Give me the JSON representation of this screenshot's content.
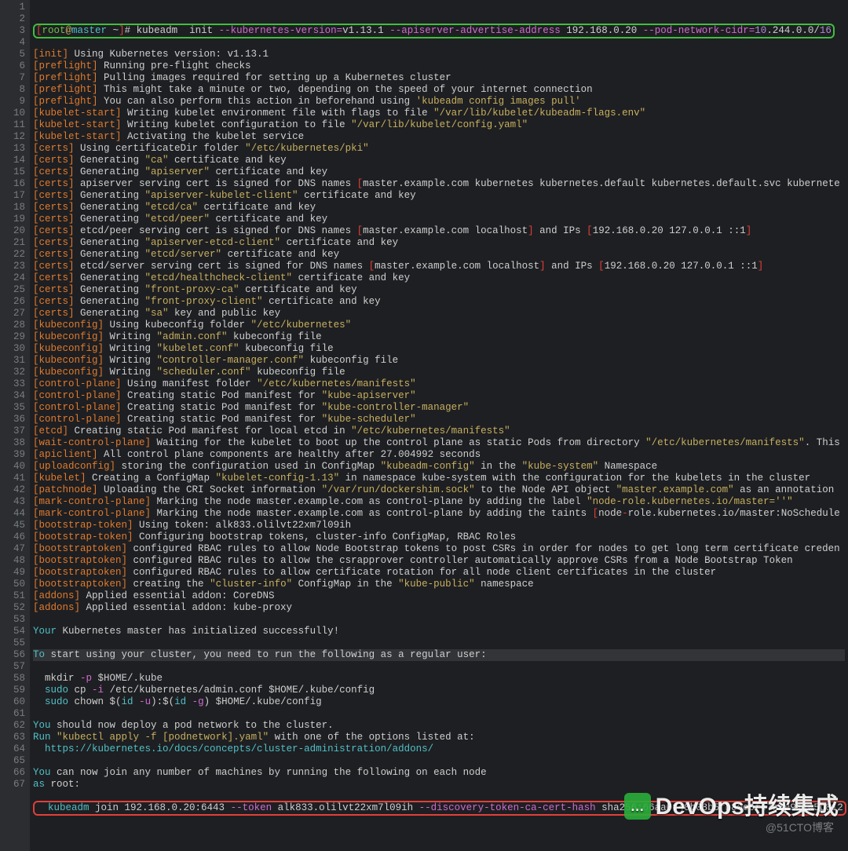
{
  "total_lines": 67,
  "highlight_line": 54,
  "box_green_line": 1,
  "box_red_line": 67,
  "watermark": {
    "text": "DevOps持续集成",
    "sub": "@51CTO博客"
  },
  "prompt": {
    "lb": "[",
    "user": "root",
    "at": "@",
    "host": "master",
    "path": " ~",
    "rb": "]",
    "hash": "# "
  },
  "cmd": {
    "bin": "kubeadm",
    "sub": "  init ",
    "f1": "--kubernetes-version=",
    "v1": "v1.13.1 ",
    "f2": "--apiserver-advertise-address ",
    "v2": "192.168.0.20 ",
    "f3": "--pod-network-cidr=",
    "v3a": "10",
    "v3b": ".244.0.0/",
    "v3c": "16"
  },
  "lines": {
    "3": [
      [
        "br",
        "[init]"
      ],
      [
        "w",
        " Using Kubernetes version: v1.13.1"
      ]
    ],
    "4": [
      [
        "br",
        "[preflight]"
      ],
      [
        "w",
        " Running pre-flight checks"
      ]
    ],
    "5": [
      [
        "br",
        "[preflight]"
      ],
      [
        "w",
        " Pulling images required for setting up a Kubernetes cluster"
      ]
    ],
    "6": [
      [
        "br",
        "[preflight]"
      ],
      [
        "w",
        " This might take a minute or two, depending on the speed of your internet connection"
      ]
    ],
    "7": [
      [
        "br",
        "[preflight]"
      ],
      [
        "w",
        " You can also perform this action in beforehand using "
      ],
      [
        "str",
        "'kubeadm config images pull'"
      ]
    ],
    "8": [
      [
        "br",
        "[kubelet-start]"
      ],
      [
        "w",
        " Writing kubelet environment file with flags to file "
      ],
      [
        "str",
        "\"/var/lib/kubelet/kubeadm-flags.env\""
      ]
    ],
    "9": [
      [
        "br",
        "[kubelet-start]"
      ],
      [
        "w",
        " Writing kubelet configuration to file "
      ],
      [
        "str",
        "\"/var/lib/kubelet/config.yaml\""
      ]
    ],
    "10": [
      [
        "br",
        "[kubelet-start]"
      ],
      [
        "w",
        " Activating the kubelet service"
      ]
    ],
    "11": [
      [
        "br",
        "[certs]"
      ],
      [
        "w",
        " Using certificateDir folder "
      ],
      [
        "str",
        "\"/etc/kubernetes/pki\""
      ]
    ],
    "12": [
      [
        "br",
        "[certs]"
      ],
      [
        "w",
        " Generating "
      ],
      [
        "str",
        "\"ca\""
      ],
      [
        "w",
        " certificate and key"
      ]
    ],
    "13": [
      [
        "br",
        "[certs]"
      ],
      [
        "w",
        " Generating "
      ],
      [
        "str",
        "\"apiserver\""
      ],
      [
        "w",
        " certificate and key"
      ]
    ],
    "14": [
      [
        "br",
        "[certs]"
      ],
      [
        "w",
        " apiserver serving cert is signed for DNS names "
      ],
      [
        "red",
        "["
      ],
      [
        "w",
        "master.example.com kubernetes kubernetes.default kubernetes.default.svc kubernete"
      ]
    ],
    "15": [
      [
        "br",
        "[certs]"
      ],
      [
        "w",
        " Generating "
      ],
      [
        "str",
        "\"apiserver-kubelet-client\""
      ],
      [
        "w",
        " certificate and key"
      ]
    ],
    "16": [
      [
        "br",
        "[certs]"
      ],
      [
        "w",
        " Generating "
      ],
      [
        "str",
        "\"etcd/ca\""
      ],
      [
        "w",
        " certificate and key"
      ]
    ],
    "17": [
      [
        "br",
        "[certs]"
      ],
      [
        "w",
        " Generating "
      ],
      [
        "str",
        "\"etcd/peer\""
      ],
      [
        "w",
        " certificate and key"
      ]
    ],
    "18": [
      [
        "br",
        "[certs]"
      ],
      [
        "w",
        " etcd/peer serving cert is signed for DNS names "
      ],
      [
        "red",
        "["
      ],
      [
        "w",
        "master.example.com localhost"
      ],
      [
        "red",
        "]"
      ],
      [
        "w",
        " and IPs "
      ],
      [
        "red",
        "["
      ],
      [
        "w",
        "192.168.0.20 127.0.0.1 ::1"
      ],
      [
        "red",
        "]"
      ]
    ],
    "19": [
      [
        "br",
        "[certs]"
      ],
      [
        "w",
        " Generating "
      ],
      [
        "str",
        "\"apiserver-etcd-client\""
      ],
      [
        "w",
        " certificate and key"
      ]
    ],
    "20": [
      [
        "br",
        "[certs]"
      ],
      [
        "w",
        " Generating "
      ],
      [
        "str",
        "\"etcd/server\""
      ],
      [
        "w",
        " certificate and key"
      ]
    ],
    "21": [
      [
        "br",
        "[certs]"
      ],
      [
        "w",
        " etcd/server serving cert is signed for DNS names "
      ],
      [
        "red",
        "["
      ],
      [
        "w",
        "master.example.com localhost"
      ],
      [
        "red",
        "]"
      ],
      [
        "w",
        " and IPs "
      ],
      [
        "red",
        "["
      ],
      [
        "w",
        "192.168.0.20 127.0.0.1 ::1"
      ],
      [
        "red",
        "]"
      ]
    ],
    "22": [
      [
        "br",
        "[certs]"
      ],
      [
        "w",
        " Generating "
      ],
      [
        "str",
        "\"etcd/healthcheck-client\""
      ],
      [
        "w",
        " certificate and key"
      ]
    ],
    "23": [
      [
        "br",
        "[certs]"
      ],
      [
        "w",
        " Generating "
      ],
      [
        "str",
        "\"front-proxy-ca\""
      ],
      [
        "w",
        " certificate and key"
      ]
    ],
    "24": [
      [
        "br",
        "[certs]"
      ],
      [
        "w",
        " Generating "
      ],
      [
        "str",
        "\"front-proxy-client\""
      ],
      [
        "w",
        " certificate and key"
      ]
    ],
    "25": [
      [
        "br",
        "[certs]"
      ],
      [
        "w",
        " Generating "
      ],
      [
        "str",
        "\"sa\""
      ],
      [
        "w",
        " key and public key"
      ]
    ],
    "26": [
      [
        "br",
        "[kubeconfig]"
      ],
      [
        "w",
        " Using kubeconfig folder "
      ],
      [
        "str",
        "\"/etc/kubernetes\""
      ]
    ],
    "27": [
      [
        "br",
        "[kubeconfig]"
      ],
      [
        "w",
        " Writing "
      ],
      [
        "str",
        "\"admin.conf\""
      ],
      [
        "w",
        " kubeconfig file"
      ]
    ],
    "28": [
      [
        "br",
        "[kubeconfig]"
      ],
      [
        "w",
        " Writing "
      ],
      [
        "str",
        "\"kubelet.conf\""
      ],
      [
        "w",
        " kubeconfig file"
      ]
    ],
    "29": [
      [
        "br",
        "[kubeconfig]"
      ],
      [
        "w",
        " Writing "
      ],
      [
        "str",
        "\"controller-manager.conf\""
      ],
      [
        "w",
        " kubeconfig file"
      ]
    ],
    "30": [
      [
        "br",
        "[kubeconfig]"
      ],
      [
        "w",
        " Writing "
      ],
      [
        "str",
        "\"scheduler.conf\""
      ],
      [
        "w",
        " kubeconfig file"
      ]
    ],
    "31": [
      [
        "br",
        "[control-plane]"
      ],
      [
        "w",
        " Using manifest folder "
      ],
      [
        "str",
        "\"/etc/kubernetes/manifests\""
      ]
    ],
    "32": [
      [
        "br",
        "[control-plane]"
      ],
      [
        "w",
        " Creating static Pod manifest for "
      ],
      [
        "str",
        "\"kube-apiserver\""
      ]
    ],
    "33": [
      [
        "br",
        "[control-plane]"
      ],
      [
        "w",
        " Creating static Pod manifest for "
      ],
      [
        "str",
        "\"kube-controller-manager\""
      ]
    ],
    "34": [
      [
        "br",
        "[control-plane]"
      ],
      [
        "w",
        " Creating static Pod manifest for "
      ],
      [
        "str",
        "\"kube-scheduler\""
      ]
    ],
    "35": [
      [
        "br",
        "[etcd]"
      ],
      [
        "w",
        " Creating static Pod manifest for local etcd in "
      ],
      [
        "str",
        "\"/etc/kubernetes/manifests\""
      ]
    ],
    "36": [
      [
        "br",
        "[wait-control-plane]"
      ],
      [
        "w",
        " Waiting for the kubelet to boot up the control plane as static Pods from directory "
      ],
      [
        "str",
        "\"/etc/kubernetes/manifests\""
      ],
      [
        "w",
        ". This"
      ]
    ],
    "37": [
      [
        "br",
        "[apiclient]"
      ],
      [
        "w",
        " All control plane components are healthy after 27.004992 seconds"
      ]
    ],
    "38": [
      [
        "br",
        "[uploadconfig]"
      ],
      [
        "w",
        " storing the configuration used in ConfigMap "
      ],
      [
        "str",
        "\"kubeadm-config\""
      ],
      [
        "w",
        " in the "
      ],
      [
        "str",
        "\"kube-system\""
      ],
      [
        "w",
        " Namespace"
      ]
    ],
    "39": [
      [
        "br",
        "[kubelet]"
      ],
      [
        "w",
        " Creating a ConfigMap "
      ],
      [
        "str",
        "\"kubelet-config-1.13\""
      ],
      [
        "w",
        " in namespace kube-system with the configuration for the kubelets in the cluster"
      ]
    ],
    "40": [
      [
        "br",
        "[patchnode]"
      ],
      [
        "w",
        " Uploading the CRI Socket information "
      ],
      [
        "str",
        "\"/var/run/dockershim.sock\""
      ],
      [
        "w",
        " to the Node API object "
      ],
      [
        "str",
        "\"master.example.com\""
      ],
      [
        "w",
        " as an annotation"
      ]
    ],
    "41": [
      [
        "br",
        "[mark-control-plane]"
      ],
      [
        "w",
        " Marking the node master.example.com as control-plane by adding the label "
      ],
      [
        "str",
        "\"node-role.kubernetes.io/master=''\""
      ]
    ],
    "42": [
      [
        "br",
        "[mark-control-plane]"
      ],
      [
        "w",
        " Marking the node master.example.com as control-plane by adding the taints "
      ],
      [
        "red",
        "["
      ],
      [
        "w",
        "node"
      ],
      [
        "red",
        "-"
      ],
      [
        "w",
        "role.kubernetes.io/master:NoSchedule"
      ]
    ],
    "43": [
      [
        "br",
        "[bootstrap-token]"
      ],
      [
        "w",
        " Using token: alk833.olilvt22xm7l09ih"
      ]
    ],
    "44": [
      [
        "br",
        "[bootstrap-token]"
      ],
      [
        "w",
        " Configuring bootstrap tokens, cluster-info ConfigMap, RBAC Roles"
      ]
    ],
    "45": [
      [
        "br",
        "[bootstraptoken]"
      ],
      [
        "w",
        " configured RBAC rules to allow Node Bootstrap tokens to post CSRs in order for nodes to get long term certificate creden"
      ]
    ],
    "46": [
      [
        "br",
        "[bootstraptoken]"
      ],
      [
        "w",
        " configured RBAC rules to allow the csrapprover controller automatically approve CSRs from a Node Bootstrap Token"
      ]
    ],
    "47": [
      [
        "br",
        "[bootstraptoken]"
      ],
      [
        "w",
        " configured RBAC rules to allow certificate rotation for all node client certificates in the cluster"
      ]
    ],
    "48": [
      [
        "br",
        "[bootstraptoken]"
      ],
      [
        "w",
        " creating the "
      ],
      [
        "str",
        "\"cluster-info\""
      ],
      [
        "w",
        " ConfigMap in the "
      ],
      [
        "str",
        "\"kube-public\""
      ],
      [
        "w",
        " namespace"
      ]
    ],
    "49": [
      [
        "br",
        "[addons]"
      ],
      [
        "w",
        " Applied essential addon: CoreDNS"
      ]
    ],
    "50": [
      [
        "br",
        "[addons]"
      ],
      [
        "w",
        " Applied essential addon: kube-proxy"
      ]
    ],
    "52": [
      [
        "cy",
        "Your"
      ],
      [
        "w",
        " Kubernetes master has initialized successfully!"
      ]
    ],
    "54": [
      [
        "cy",
        "To"
      ],
      [
        "w",
        " start using your cluster, you need to run the following as a regular user:"
      ]
    ],
    "56": [
      [
        "w",
        "  mkdir "
      ],
      [
        "kw",
        "-p"
      ],
      [
        "w",
        " $HOME/.kube"
      ]
    ],
    "57": [
      [
        "w",
        "  "
      ],
      [
        "cy",
        "sudo"
      ],
      [
        "w",
        " cp "
      ],
      [
        "kw",
        "-i"
      ],
      [
        "w",
        " /etc/kubernetes/admin.conf $HOME/.kube/config"
      ]
    ],
    "58": [
      [
        "w",
        "  "
      ],
      [
        "cy",
        "sudo"
      ],
      [
        "w",
        " chown $("
      ],
      [
        "cy",
        "id"
      ],
      [
        "w",
        " "
      ],
      [
        "kw",
        "-u"
      ],
      [
        "w",
        "):$("
      ],
      [
        "cy",
        "id"
      ],
      [
        "w",
        " "
      ],
      [
        "kw",
        "-g"
      ],
      [
        "w",
        ") $HOME/.kube/config"
      ]
    ],
    "60": [
      [
        "cy",
        "You"
      ],
      [
        "w",
        " should now deploy a pod network to the cluster."
      ]
    ],
    "61": [
      [
        "cy",
        "Run"
      ],
      [
        "w",
        " "
      ],
      [
        "str",
        "\"kubectl apply -f [podnetwork].yaml\""
      ],
      [
        "w",
        " with one of the options listed at:"
      ]
    ],
    "62": [
      [
        "w",
        "  "
      ],
      [
        "cy",
        "https://kubernetes.io/docs/concepts/cluster-administration/addons/"
      ]
    ],
    "64": [
      [
        "cy",
        "You"
      ],
      [
        "w",
        " can now join any number of machines by running the following on each node"
      ]
    ],
    "65": [
      [
        "cy",
        "as"
      ],
      [
        "w",
        " root:"
      ]
    ],
    "67": [
      [
        "w",
        "  "
      ],
      [
        "cy",
        "kubeadm"
      ],
      [
        "w",
        " join 192.168.0.20:6443 "
      ],
      [
        "kw",
        "--token"
      ],
      [
        "w",
        " alk833.olilvt22xm7l09ih "
      ],
      [
        "kw",
        "--discovery-token-ca-cert-hash"
      ],
      [
        "w",
        " sha256:66aa0f48b08b5fb80e0f47b3e91145b812"
      ]
    ]
  }
}
